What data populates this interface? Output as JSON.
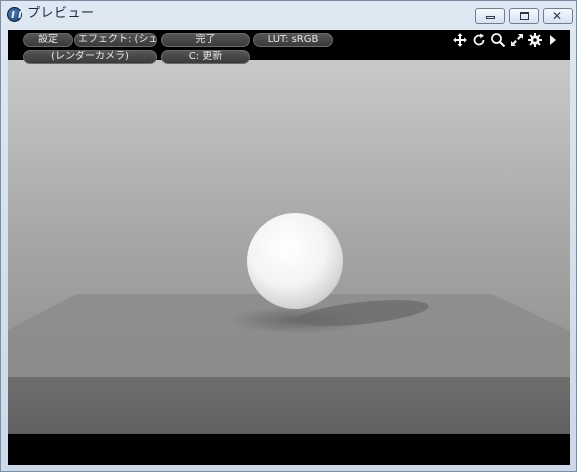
{
  "window": {
    "title": "プレビュー"
  },
  "toolbar": {
    "settings_label": "設定",
    "effect_label": "エフェクト: (シェ...",
    "done_label": "完了",
    "lut_label": "LUT: sRGB",
    "camera_label": "(レンダーカメラ)",
    "refresh_label": "C: 更新"
  },
  "icons": [
    "app-icon",
    "minimize-icon",
    "maximize-icon",
    "close-icon",
    "move-icon",
    "rotate-icon",
    "zoom-icon",
    "fit-icon",
    "gear-icon",
    "chevron-right-icon"
  ],
  "colors": {
    "viewport_background": "#000000",
    "sky_top": "#c9c9c9",
    "floor": "#8c8c8c",
    "sphere": "#f2f2f2",
    "pill_background": "#474747",
    "pill_text": "#e8e8e8"
  }
}
